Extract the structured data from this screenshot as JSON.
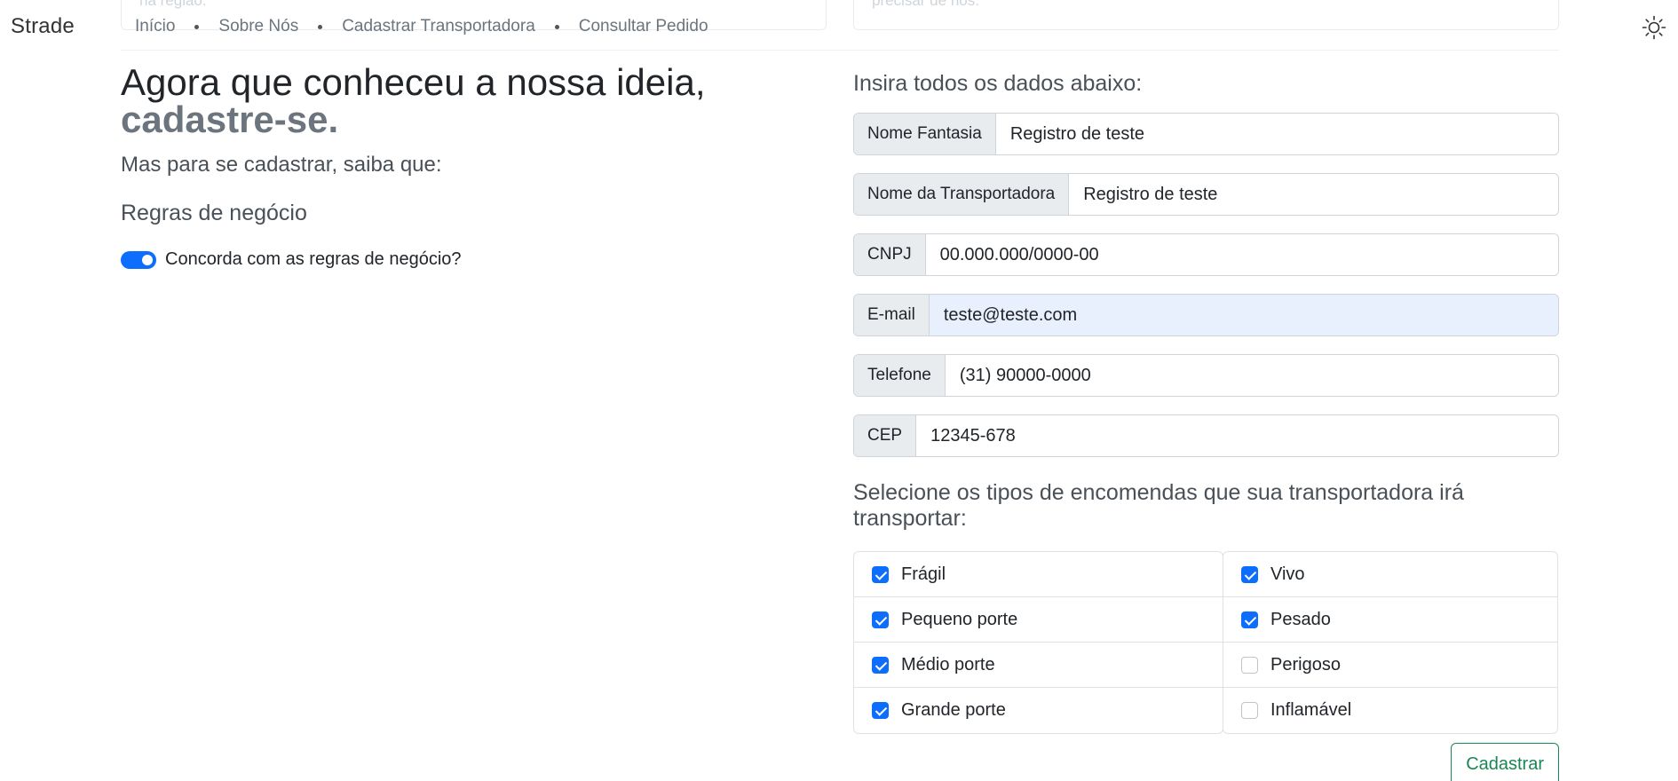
{
  "background_cards": [
    {
      "text": "na região."
    },
    {
      "text": "precisar de nós."
    }
  ],
  "navbar": {
    "brand": "Strade",
    "links": [
      "Início",
      "Sobre Nós",
      "Cadastrar Transportadora",
      "Consultar Pedido"
    ],
    "theme_icon": "sun-icon"
  },
  "left": {
    "heading": "Agora que conheceu a nossa ideia,",
    "heading_strong": "cadastre-se.",
    "subheading": "Mas para se cadastrar, saiba que:",
    "rules_title": "Regras de negócio",
    "agree_label": "Concorda com as regras de negócio?",
    "agree_checked": true
  },
  "form": {
    "title": "Insira todos os dados abaixo:",
    "fields": [
      {
        "label": "Nome Fantasia",
        "value": "Registro de teste"
      },
      {
        "label": "Nome da Transportadora",
        "value": "Registro de teste"
      },
      {
        "label": "CNPJ",
        "value": "00.000.000/0000-00"
      },
      {
        "label": "E-mail",
        "value": "teste@teste.com"
      },
      {
        "label": "Telefone",
        "value": "(31) 90000-0000"
      },
      {
        "label": "CEP",
        "value": "12345-678"
      }
    ],
    "types_title": "Selecione os tipos de encomendas que sua transportadora irá transportar:",
    "types_left": [
      {
        "label": "Frágil",
        "checked": true
      },
      {
        "label": "Pequeno porte",
        "checked": true
      },
      {
        "label": "Médio porte",
        "checked": true
      },
      {
        "label": "Grande porte",
        "checked": true
      }
    ],
    "types_right": [
      {
        "label": "Vivo",
        "checked": true
      },
      {
        "label": "Pesado",
        "checked": true
      },
      {
        "label": "Perigoso",
        "checked": false
      },
      {
        "label": "Inflamável",
        "checked": false
      }
    ],
    "submit_label": "Cadastrar"
  },
  "colors": {
    "primary": "#0d6efd",
    "success": "#198754",
    "muted": "#6c757d",
    "autofill": "#e8f0fe"
  }
}
